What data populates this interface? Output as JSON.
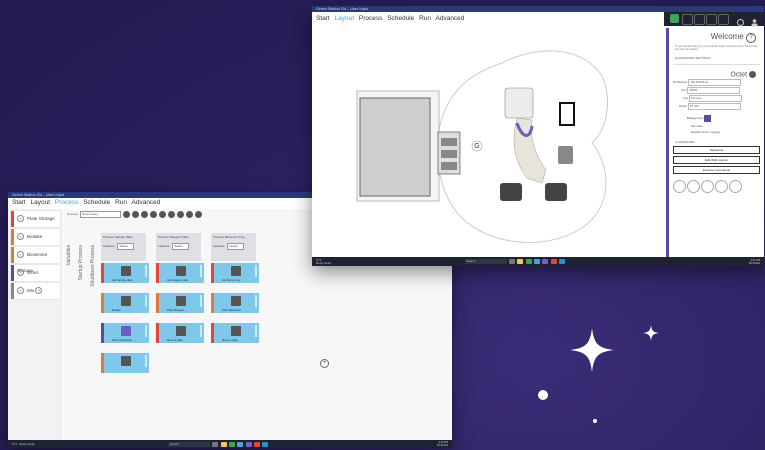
{
  "window_left": {
    "title": "Green Button Go - User Input",
    "menu": [
      "Start",
      "Layout",
      "Process",
      "Schedule",
      "Run",
      "Advanced"
    ],
    "active_menu": "Process",
    "sidebar": [
      {
        "label": "Plate Storage",
        "color": "#e0463c"
      },
      {
        "label": "Biotake",
        "color": "#e07a3c"
      },
      {
        "label": "Biosensor Storage",
        "color": "#e07a3c"
      },
      {
        "label": "Octet",
        "color": "#5a4ba0"
      },
      {
        "label": "Mix",
        "color": "#888888"
      }
    ],
    "process_label": "Process",
    "process_select": "Octet Assay",
    "vertical_tabs": [
      "Variables",
      "Startup Process",
      "Shutdown Process"
    ],
    "columns": [
      {
        "process": "Sample Plate",
        "labware": "Select",
        "steps": [
          "Get Sample plate",
          "Biotake",
          "Place Octet/plate"
        ]
      },
      {
        "process": "Reagent Plate",
        "labware": "Select",
        "steps": [
          "Get Reagent plate",
          "Place Reagent",
          "Move to plate"
        ]
      },
      {
        "process": "Biosensor Tray",
        "labware": "Select",
        "steps": [
          "Get Sensor tray",
          "Place Biosensor",
          "Move to plate"
        ]
      }
    ],
    "add_symbol": "+"
  },
  "window_right": {
    "title": "Green Button Go - User Input",
    "menu": [
      "Start",
      "Layout",
      "Process",
      "Schedule",
      "Run",
      "Advanced"
    ],
    "active_menu": "Layout",
    "panel": {
      "welcome": "Welcome",
      "welcome_text": "To get started setting up your worksfl, drag instruments from the left tool bar onto the surface.",
      "advanced_settings": "ADVANCED SETTINGS",
      "instrument": "Octet",
      "fields": [
        {
          "label": "IP Address",
          "value": "192.168.86.21"
        },
        {
          "label": "Port",
          "value": "25000"
        },
        {
          "label": "City",
          "value": "Fremont"
        },
        {
          "label": "Robot",
          "value": "PF 400"
        }
      ],
      "background_label": "Background",
      "simulate_label": "Simulate",
      "disable_logging": "Disable Error Logging",
      "advanced": "ADVANCED",
      "buttons": [
        "Sequence",
        "Edit Work Layout",
        "Execute Commands"
      ]
    }
  },
  "taskbar": {
    "weather_temp": "67°F",
    "weather_text": "Mostly cloudy",
    "search": "Search",
    "time": "4:22 PM",
    "date": "5/21/2024"
  },
  "colors": {
    "accent": "#5a4ba0",
    "step_blue": "#7fc8ea",
    "title_bar": "#2a3a78",
    "background": "#2a1f5c"
  }
}
